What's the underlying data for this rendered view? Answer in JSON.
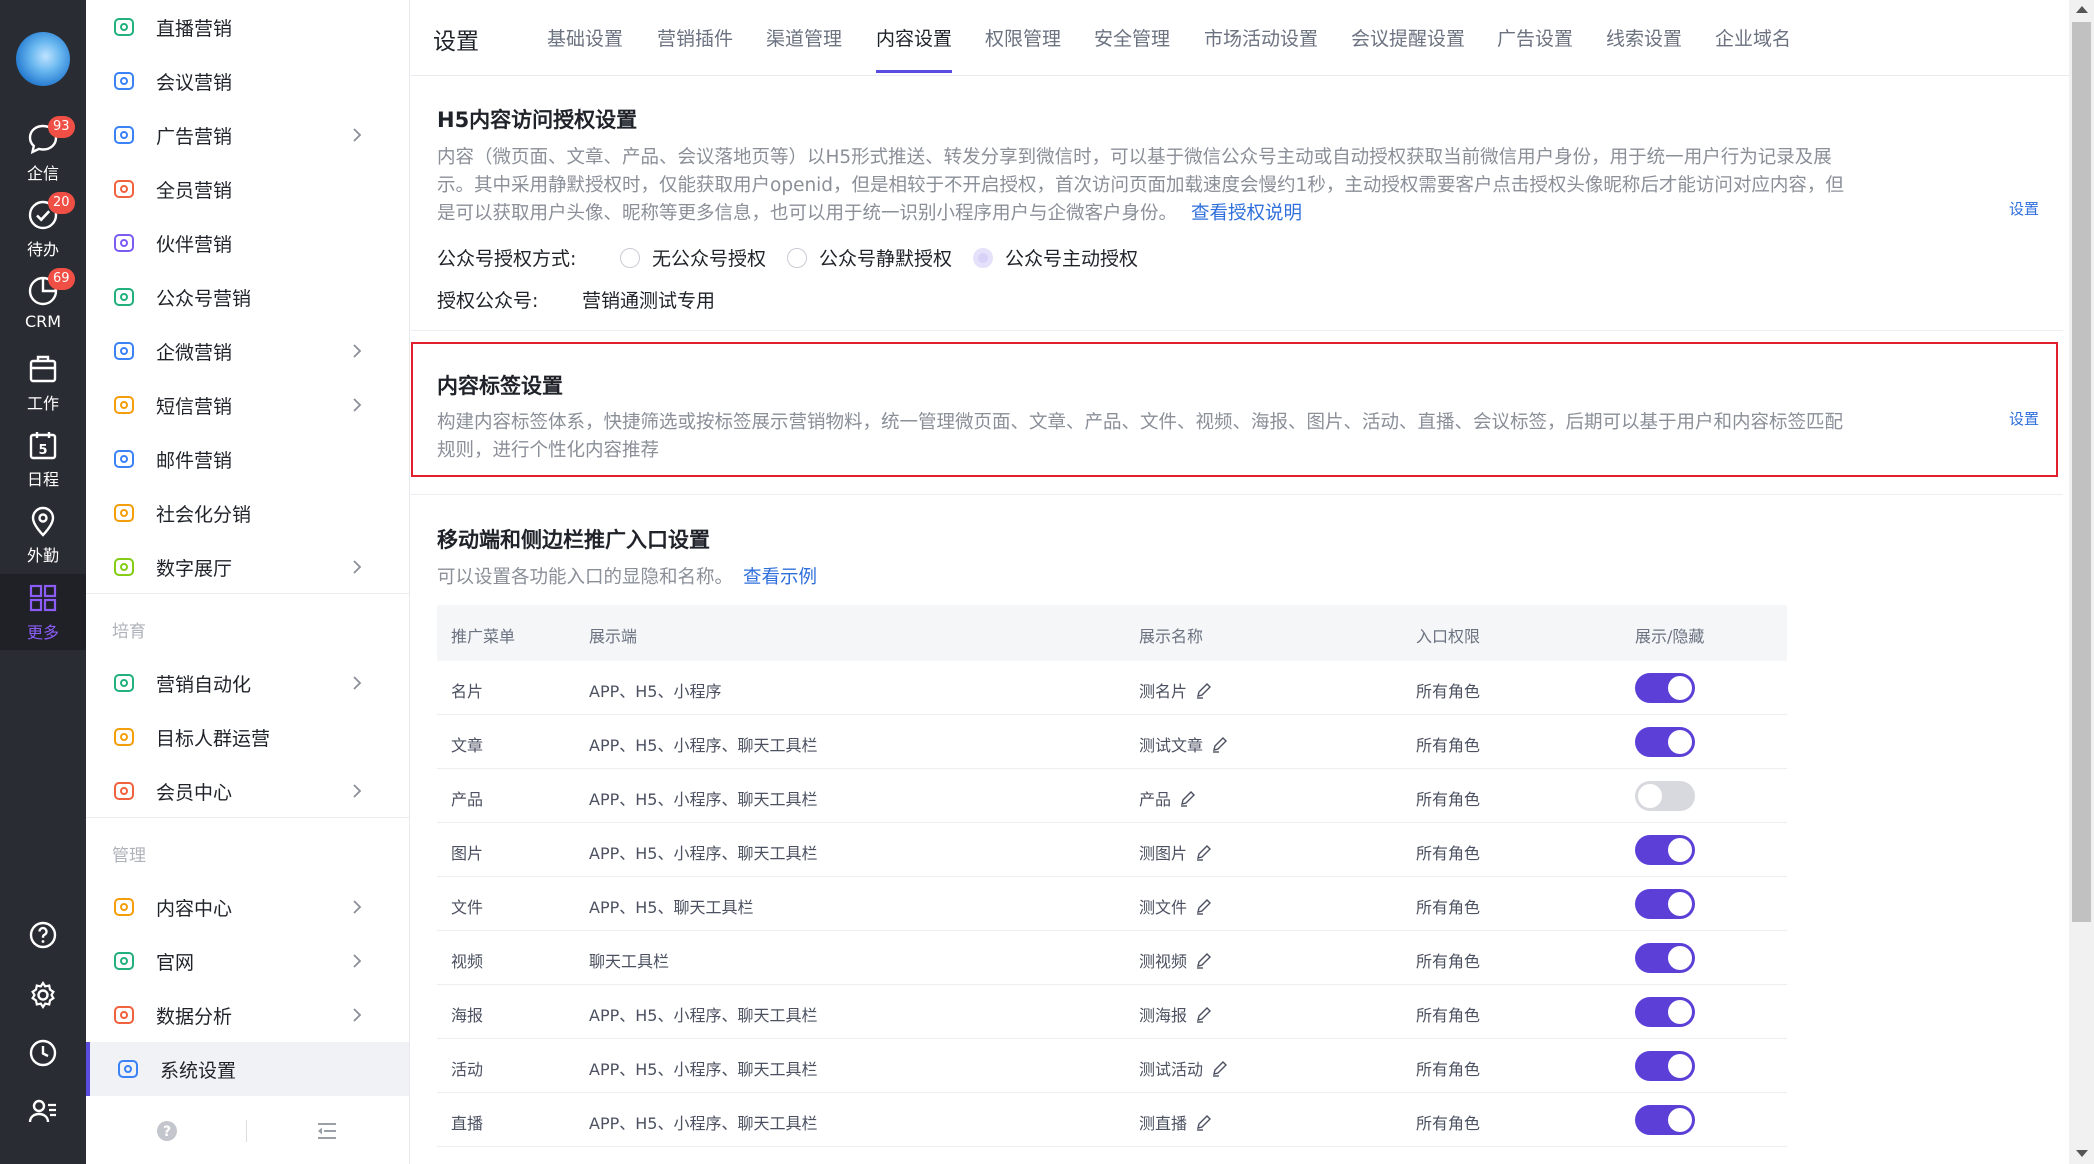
{
  "rail": {
    "items": [
      {
        "label": "企信",
        "icon": "chat-icon",
        "badge": "93"
      },
      {
        "label": "待办",
        "icon": "todo-check-icon",
        "badge": "20"
      },
      {
        "label": "CRM",
        "icon": "crm-pie-icon",
        "badge": "69"
      },
      {
        "label": "工作",
        "icon": "briefcase-icon",
        "badge": ""
      },
      {
        "label": "日程",
        "icon": "calendar-icon",
        "badge": "",
        "day": "5"
      },
      {
        "label": "外勤",
        "icon": "location-pin-icon",
        "badge": ""
      },
      {
        "label": "更多",
        "icon": "grid-more-icon",
        "badge": ""
      }
    ],
    "bottom_icons": [
      "help-icon",
      "settings-icon",
      "history-icon",
      "contacts-icon"
    ]
  },
  "menu": {
    "items": [
      {
        "label": "直播营销",
        "icon": "live-video-icon",
        "color": "#22b07d",
        "arrow": false
      },
      {
        "label": "会议营销",
        "icon": "meeting-people-icon",
        "color": "#3b82f6",
        "arrow": false
      },
      {
        "label": "广告营销",
        "icon": "ad-icon",
        "color": "#3b82f6",
        "arrow": true
      },
      {
        "label": "全员营销",
        "icon": "staff-icon",
        "color": "#f0623d",
        "arrow": false
      },
      {
        "label": "伙伴营销",
        "icon": "partner-icon",
        "color": "#7c5cf0",
        "arrow": false
      },
      {
        "label": "公众号营销",
        "icon": "wechat-official-icon",
        "color": "#22b07d",
        "arrow": false
      },
      {
        "label": "企微营销",
        "icon": "wecom-icon",
        "color": "#3b82f6",
        "arrow": true
      },
      {
        "label": "短信营销",
        "icon": "sms-icon",
        "color": "#f59e0b",
        "arrow": true
      },
      {
        "label": "邮件营销",
        "icon": "mail-icon",
        "color": "#3b82f6",
        "arrow": false
      },
      {
        "label": "社会化分销",
        "icon": "distribution-icon",
        "color": "#f59e0b",
        "arrow": false
      },
      {
        "label": "数字展厅",
        "icon": "digital-hall-icon",
        "color": "#84cc16",
        "arrow": true
      }
    ],
    "section_cultivate": "培育",
    "cultivate_items": [
      {
        "label": "营销自动化",
        "icon": "automation-icon",
        "color": "#22b07d",
        "arrow": true
      },
      {
        "label": "目标人群运营",
        "icon": "target-group-icon",
        "color": "#f59e0b",
        "arrow": false
      },
      {
        "label": "会员中心",
        "icon": "member-star-icon",
        "color": "#f0623d",
        "arrow": true
      }
    ],
    "section_manage": "管理",
    "manage_items": [
      {
        "label": "内容中心",
        "icon": "content-doc-icon",
        "color": "#f59e0b",
        "arrow": true
      },
      {
        "label": "官网",
        "icon": "website-globe-icon",
        "color": "#22b07d",
        "arrow": true
      },
      {
        "label": "数据分析",
        "icon": "data-chart-icon",
        "color": "#f0623d",
        "arrow": true
      },
      {
        "label": "系统设置",
        "icon": "system-gear-icon",
        "color": "#3b82f6",
        "arrow": false
      }
    ],
    "footer_icons": [
      "help-circle-icon",
      "collapse-menu-icon"
    ]
  },
  "header": {
    "page_title": "设置",
    "tabs": [
      "基础设置",
      "营销插件",
      "渠道管理",
      "内容设置",
      "权限管理",
      "安全管理",
      "市场活动设置",
      "会议提醒设置",
      "广告设置",
      "线索设置",
      "企业域名"
    ],
    "active_tab": "内容设置"
  },
  "h5_auth": {
    "title": "H5内容访问授权设置",
    "desc_line1": "内容（微页面、文章、产品、会议落地页等）以H5形式推送、转发分享到微信时，可以基于微信公众号主动或自动授权获取当前微信用户身份，用于统一用户行为记录及展",
    "desc_line2": "示。其中采用静默授权时，仅能获取用户openid，但是相较于不开启授权，首次访问页面加载速度会慢约1秒，主动授权需要客户点击授权头像昵称后才能访问对应内容，但",
    "desc_line3": "是可以获取用户头像、昵称等更多信息，也可以用于统一识别小程序用户与企微客户身份。",
    "link": "查看授权说明",
    "set": "设置",
    "mode_label": "公众号授权方式:",
    "options": [
      "无公众号授权",
      "公众号静默授权",
      "公众号主动授权"
    ],
    "selected_option": "公众号主动授权",
    "account_label": "授权公众号:",
    "account_value": "营销通测试专用"
  },
  "content_tag": {
    "title": "内容标签设置",
    "desc_line1": "构建内容标签体系，快捷筛选或按标签展示营销物料，统一管理微页面、文章、产品、文件、视频、海报、图片、活动、直播、会议标签，后期可以基于用户和内容标签匹配",
    "desc_line2": "规则，进行个性化内容推荐",
    "set": "设置",
    "highlight_color": "#e0202c"
  },
  "entry": {
    "title": "移动端和侧边栏推广入口设置",
    "desc": "可以设置各功能入口的显隐和名称。",
    "link": "查看示例",
    "columns": [
      "推广菜单",
      "展示端",
      "展示名称",
      "入口权限",
      "展示/隐藏"
    ],
    "rows": [
      {
        "menu": "名片",
        "platforms": "APP、H5、小程序",
        "name": "测名片",
        "permission": "所有角色",
        "visible": true
      },
      {
        "menu": "文章",
        "platforms": "APP、H5、小程序、聊天工具栏",
        "name": "测试文章",
        "permission": "所有角色",
        "visible": true
      },
      {
        "menu": "产品",
        "platforms": "APP、H5、小程序、聊天工具栏",
        "name": "产品",
        "permission": "所有角色",
        "visible": false
      },
      {
        "menu": "图片",
        "platforms": "APP、H5、小程序、聊天工具栏",
        "name": "测图片",
        "permission": "所有角色",
        "visible": true
      },
      {
        "menu": "文件",
        "platforms": "APP、H5、聊天工具栏",
        "name": "测文件",
        "permission": "所有角色",
        "visible": true
      },
      {
        "menu": "视频",
        "platforms": "聊天工具栏",
        "name": "测视频",
        "permission": "所有角色",
        "visible": true
      },
      {
        "menu": "海报",
        "platforms": "APP、H5、小程序、聊天工具栏",
        "name": "测海报",
        "permission": "所有角色",
        "visible": true
      },
      {
        "menu": "活动",
        "platforms": "APP、H5、小程序、聊天工具栏",
        "name": "测试活动",
        "permission": "所有角色",
        "visible": true
      },
      {
        "menu": "直播",
        "platforms": "APP、H5、小程序、聊天工具栏",
        "name": "测直播",
        "permission": "所有角色",
        "visible": true
      }
    ]
  },
  "colors": {
    "accent": "#5b3fd6",
    "link": "#2f6fdc",
    "rail_bg": "#2a2c33",
    "badge": "#f04f45"
  }
}
